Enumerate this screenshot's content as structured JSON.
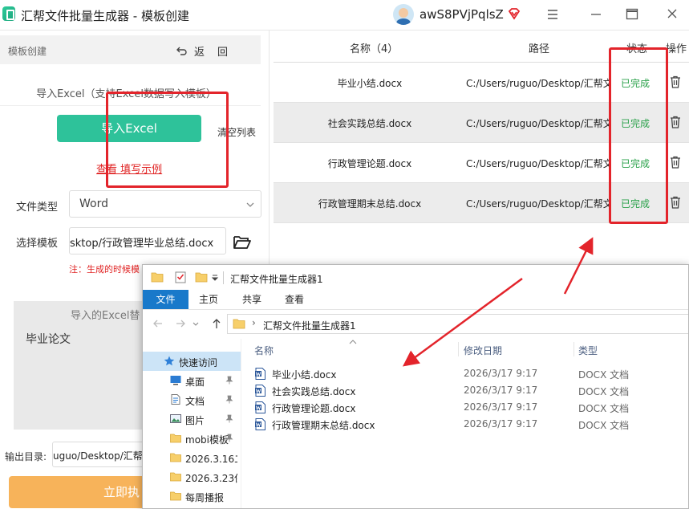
{
  "app": {
    "title": "汇帮文件批量生成器 - 模板创建",
    "username": "awS8PVjPqlsZ"
  },
  "left": {
    "header_title": "模板创建",
    "back_label": "返",
    "back_label2": "回",
    "import_hint": "导入Excel（支持Excel数据写入模板）",
    "import_button": "导入Excel",
    "clear_list": "清空列表",
    "example_link": "查看 填写示例",
    "file_type_label": "文件类型",
    "file_type_value": "Word",
    "template_label": "选择模板",
    "template_value": "sktop/行政管理毕业总结.docx",
    "template_note": "注：生成的时候模",
    "preview_title": "导入的Excel替",
    "preview_content": "毕业论文",
    "output_label": "输出目录:",
    "output_value": "uguo/Desktop/汇帮文",
    "generate_button": "立即执"
  },
  "table": {
    "headers": {
      "name": "名称（4）",
      "path": "路径",
      "status": "状态",
      "action": "操作"
    },
    "rows": [
      {
        "name": "毕业小结.docx",
        "path": "C:/Users/ruguo/Desktop/汇帮文",
        "status": "已完成"
      },
      {
        "name": "社会实践总结.docx",
        "path": "C:/Users/ruguo/Desktop/汇帮文",
        "status": "已完成"
      },
      {
        "name": "行政管理论题.docx",
        "path": "C:/Users/ruguo/Desktop/汇帮文",
        "status": "已完成"
      },
      {
        "name": "行政管理期末总结.docx",
        "path": "C:/Users/ruguo/Desktop/汇帮文",
        "status": "已完成"
      }
    ]
  },
  "explorer": {
    "title": "汇帮文件批量生成器1",
    "tabs": [
      "文件",
      "主页",
      "共享",
      "查看"
    ],
    "address": "汇帮文件批量生成器1",
    "nav_items": [
      {
        "label": "快速访问",
        "icon": "star-icon"
      },
      {
        "label": "桌面",
        "icon": "desktop-icon"
      },
      {
        "label": "文档",
        "icon": "document-icon"
      },
      {
        "label": "图片",
        "icon": "picture-icon"
      },
      {
        "label": "mobi模板",
        "icon": "folder-icon"
      },
      {
        "label": "2026.3.16二",
        "icon": "folder-icon"
      },
      {
        "label": "2026.3.23保",
        "icon": "folder-icon"
      },
      {
        "label": "每周播报",
        "icon": "folder-icon"
      }
    ],
    "columns": {
      "name": "名称",
      "date": "修改日期",
      "type": "类型"
    },
    "files": [
      {
        "name": "毕业小结.docx",
        "date": "2026/3/17 9:17",
        "type": "DOCX 文档"
      },
      {
        "name": "社会实践总结.docx",
        "date": "2026/3/17 9:17",
        "type": "DOCX 文档"
      },
      {
        "name": "行政管理论题.docx",
        "date": "2026/3/17 9:17",
        "type": "DOCX 文档"
      },
      {
        "name": "行政管理期末总结.docx",
        "date": "2026/3/17 9:17",
        "type": "DOCX 文档"
      }
    ]
  },
  "colors": {
    "accent_green": "#2ec29a",
    "status_green": "#2aa14a",
    "highlight_red": "#e3242b",
    "generate_orange": "#f7b35a",
    "explorer_blue": "#1979ca"
  }
}
